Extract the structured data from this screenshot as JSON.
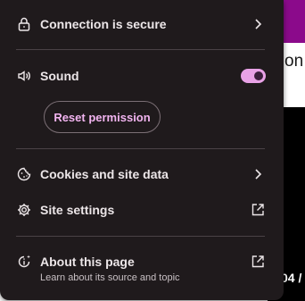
{
  "colors": {
    "panel_background": "#1f1a1c",
    "accent": "#e8a2e6",
    "page_purple": "#8b0a8b"
  },
  "background_page": {
    "text_fragment_1": "on",
    "text_fragment_2": "04 /"
  },
  "popup": {
    "connection": {
      "label": "Connection is secure",
      "icon": "lock-icon",
      "trailing_icon": "chevron-right-icon"
    },
    "sound": {
      "label": "Sound",
      "icon": "speaker-icon",
      "toggle_on": true,
      "reset_button_label": "Reset permission"
    },
    "cookies": {
      "label": "Cookies and site data",
      "icon": "cookie-icon",
      "trailing_icon": "chevron-right-icon"
    },
    "site_settings": {
      "label": "Site settings",
      "icon": "gear-icon",
      "trailing_icon": "external-link-icon"
    },
    "about": {
      "label": "About this page",
      "sublabel": "Learn about its source and topic",
      "icon": "info-sparkle-icon",
      "trailing_icon": "external-link-icon"
    }
  }
}
